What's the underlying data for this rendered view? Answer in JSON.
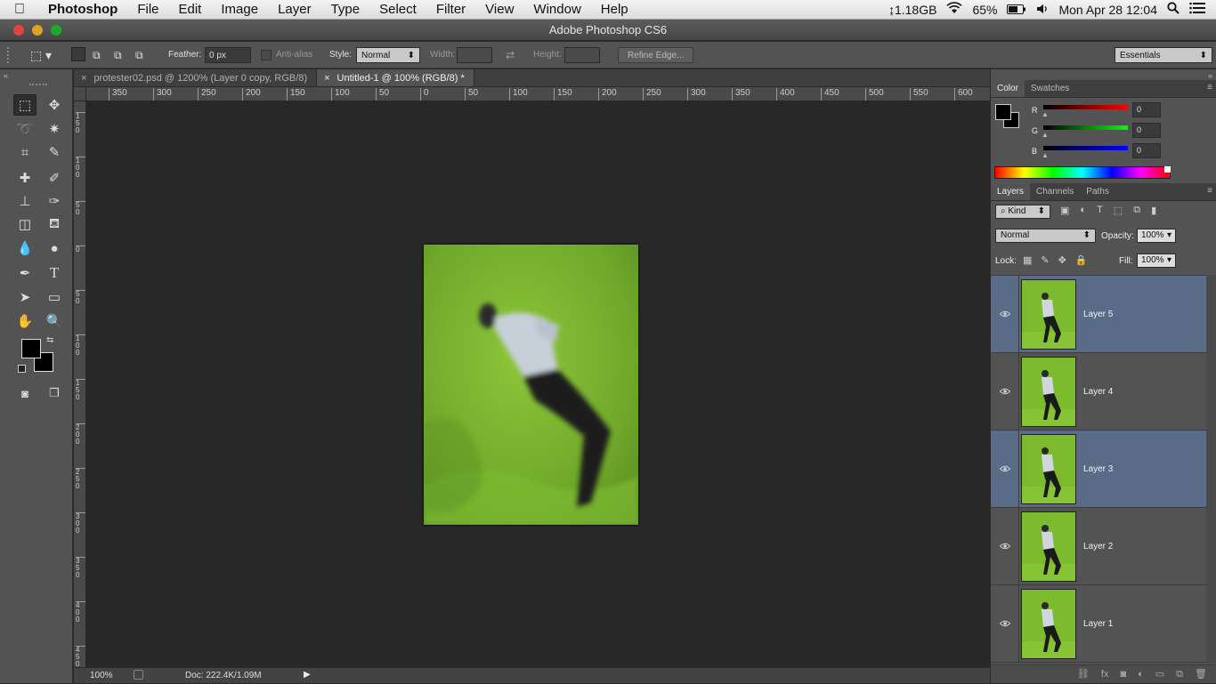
{
  "menubar": {
    "app": "Photoshop",
    "items": [
      "File",
      "Edit",
      "Image",
      "Layer",
      "Type",
      "Select",
      "Filter",
      "View",
      "Window",
      "Help"
    ],
    "status_net": "↨1.18GB",
    "battery": "65%",
    "datetime": "Mon Apr 28  12:04"
  },
  "window_title": "Adobe Photoshop CS6",
  "options": {
    "feather_label": "Feather:",
    "feather_value": "0 px",
    "antialias_label": "Anti-alias",
    "style_label": "Style:",
    "style_value": "Normal",
    "width_label": "Width:",
    "height_label": "Height:",
    "refine_edge": "Refine Edge...",
    "workspace": "Essentials"
  },
  "doc_tabs": [
    {
      "label": "protester02.psd @ 1200% (Layer 0 copy, RGB/8)"
    },
    {
      "label": "Untitled-1 @ 100% (RGB/8) *"
    }
  ],
  "ruler_top": [
    "350",
    "300",
    "250",
    "200",
    "150",
    "100",
    "50",
    "0",
    "50",
    "100",
    "150",
    "200",
    "250",
    "300",
    "350",
    "400",
    "450",
    "500",
    "550",
    "600"
  ],
  "ruler_left": [
    "1\n5\n0",
    "1\n0\n0",
    "5\n0",
    "0",
    "5\n0",
    "1\n0\n0",
    "1\n5\n0",
    "2\n0\n0",
    "2\n5\n0",
    "3\n0\n0",
    "3\n5\n0",
    "4\n0\n0",
    "4\n5\n0"
  ],
  "status": {
    "zoom": "100%",
    "doc": "Doc: 222.4K/1.09M"
  },
  "color_panel": {
    "tabs": [
      "Color",
      "Swatches"
    ],
    "channels": [
      {
        "label": "R",
        "value": "0"
      },
      {
        "label": "G",
        "value": "0"
      },
      {
        "label": "B",
        "value": "0"
      }
    ]
  },
  "layers_panel": {
    "tabs": [
      "Layers",
      "Channels",
      "Paths"
    ],
    "filter": "Kind",
    "blend_mode": "Normal",
    "opacity_label": "Opacity:",
    "opacity_value": "100%",
    "lock_label": "Lock:",
    "fill_label": "Fill:",
    "fill_value": "100%",
    "layers": [
      {
        "name": "Layer 5",
        "selected": true
      },
      {
        "name": "Layer 4",
        "selected": false
      },
      {
        "name": "Layer 3",
        "selected": true
      },
      {
        "name": "Layer 2",
        "selected": false
      },
      {
        "name": "Layer 1",
        "selected": false
      }
    ]
  },
  "colors": {
    "green_screen": "#7fbb2c",
    "selection_blue": "#5a6b88",
    "panel_gray": "#535353"
  }
}
